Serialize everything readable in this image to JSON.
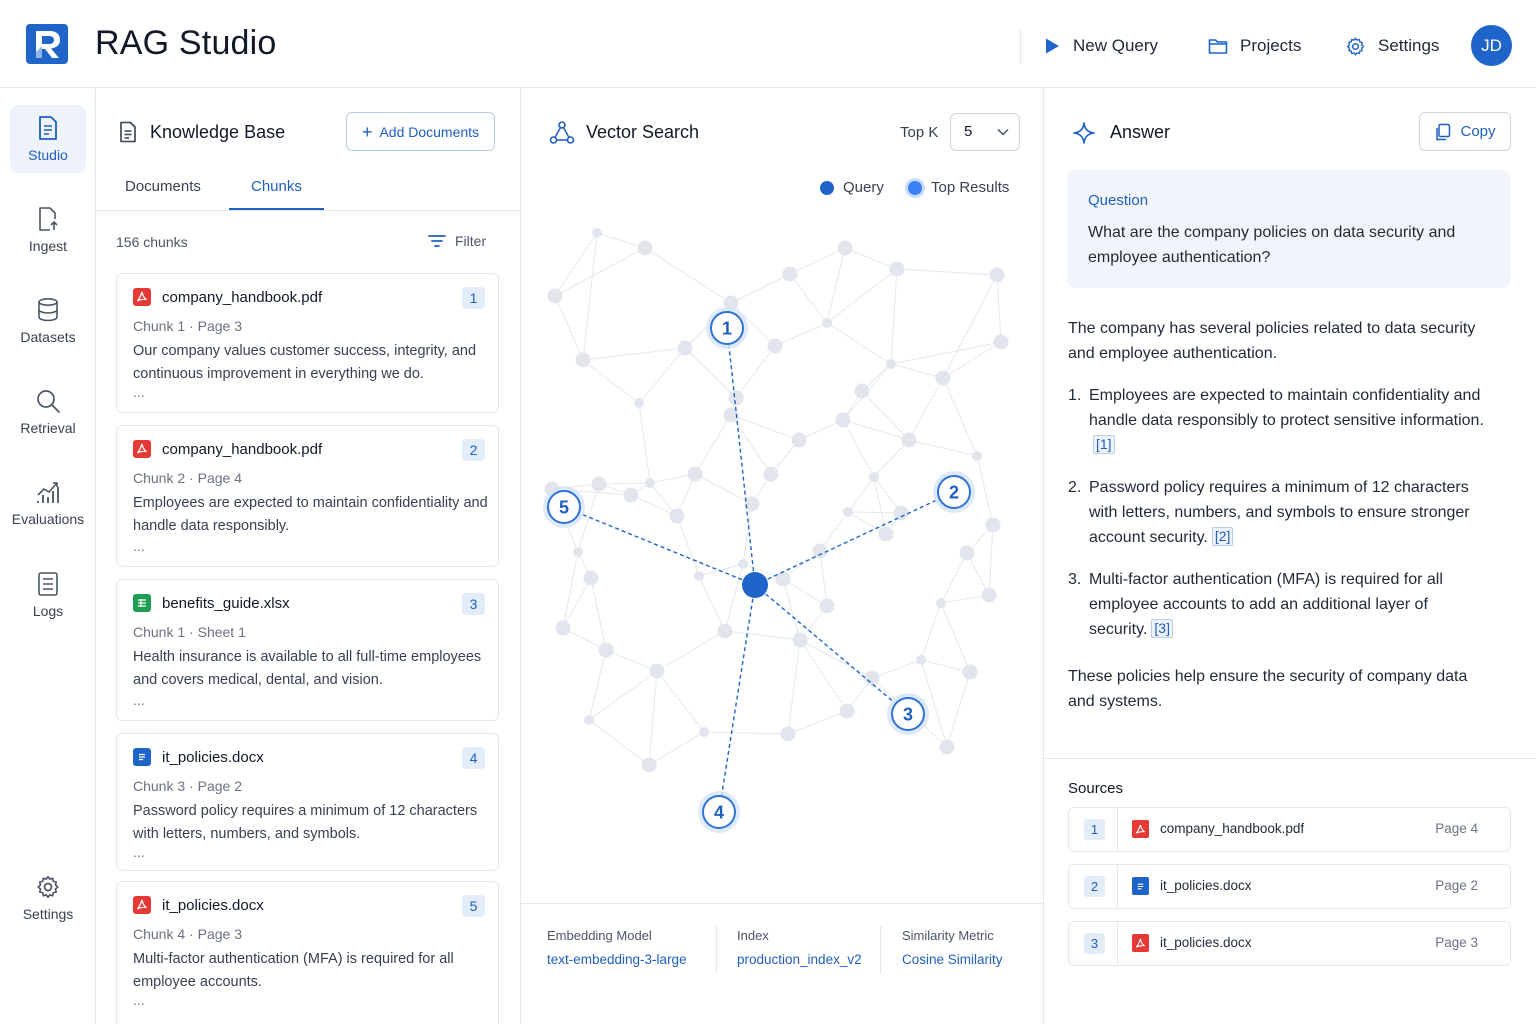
{
  "app": {
    "title": "RAG Studio",
    "logo_letter": "R",
    "brand_color": "#1f64c8"
  },
  "header": {
    "new_query": "New Query",
    "projects": "Projects",
    "settings": "Settings",
    "avatar_initials": "JD"
  },
  "nav": {
    "items": [
      {
        "label": "Studio",
        "icon": "document-icon",
        "active": true
      },
      {
        "label": "Ingest",
        "icon": "file-upload-icon"
      },
      {
        "label": "Datasets",
        "icon": "database-icon"
      },
      {
        "label": "Retrieval",
        "icon": "search-icon"
      },
      {
        "label": "Evaluations",
        "icon": "chart-icon"
      },
      {
        "label": "Logs",
        "icon": "log-icon"
      }
    ],
    "settings": "Settings"
  },
  "knowledge_base": {
    "title": "Knowledge Base",
    "add_button": "Add Documents",
    "tabs": [
      "Documents",
      "Chunks"
    ],
    "active_tab": "Chunks",
    "count": "156 chunks",
    "filter": "Filter",
    "chunks": [
      {
        "file": "company_handbook.pdf",
        "type": "pdf",
        "rank": "1",
        "chunk": "Chunk 1",
        "location": "Page 3",
        "text": "Our company values customer success, integrity, and continuous improvement in everything we do.",
        "ellipsis": "..."
      },
      {
        "file": "company_handbook.pdf",
        "type": "pdf",
        "rank": "2",
        "chunk": "Chunk 2",
        "location": "Page 4",
        "text": "Employees are expected to maintain confidentiality and handle data responsibly.",
        "ellipsis": "..."
      },
      {
        "file": "benefits_guide.xlsx",
        "type": "xlsx",
        "rank": "3",
        "chunk": "Chunk 1",
        "location": "Sheet 1",
        "text": "Health insurance is available to all full-time employees and covers medical, dental, and vision.",
        "ellipsis": "..."
      },
      {
        "file": "it_policies.docx",
        "type": "docx",
        "rank": "4",
        "chunk": "Chunk 3",
        "location": "Page 2",
        "text": "Password policy requires a minimum of 12 characters with letters, numbers, and symbols.",
        "ellipsis": "..."
      },
      {
        "file": "it_policies.docx",
        "type": "pdf",
        "rank": "5",
        "chunk": "Chunk 4",
        "location": "Page 3",
        "text": "Multi-factor authentication (MFA) is required for all employee accounts.",
        "ellipsis": "..."
      }
    ]
  },
  "vector_search": {
    "title": "Vector Search",
    "top_k_label": "Top K",
    "top_k_value": "5",
    "legend_query": "Query",
    "legend_results": "Top Results",
    "result_labels": [
      "1",
      "2",
      "3",
      "4",
      "5"
    ],
    "embedding_model_label": "Embedding Model",
    "embedding_model": "text-embedding-3-large",
    "index_label": "Index",
    "index": "production_index_v2",
    "metric_label": "Similarity Metric",
    "metric": "Cosine Similarity"
  },
  "answer": {
    "title": "Answer",
    "copy": "Copy",
    "question_label": "Question",
    "question": "What are the company policies on data security and employee authentication?",
    "intro": "The company has several policies related to data security and employee authentication.",
    "points": [
      {
        "num": "1.",
        "text": "Employees are expected to maintain confidentiality and handle data responsibly to protect sensitive information.",
        "cite": "[1]"
      },
      {
        "num": "2.",
        "text": "Password policy requires a minimum of 12 characters with letters, numbers, and symbols to ensure stronger account security.",
        "cite": "[2]"
      },
      {
        "num": "3.",
        "text": "Multi-factor authentication (MFA) is required for all employee accounts to add an additional layer of security.",
        "cite": "[3]"
      }
    ],
    "outro": "These policies help ensure the security of company data and systems.",
    "sources_title": "Sources",
    "sources": [
      {
        "num": "1",
        "file": "company_handbook.pdf",
        "type": "pdf",
        "page": "Page 4"
      },
      {
        "num": "2",
        "file": "it_policies.docx",
        "type": "docx",
        "page": "Page 2"
      },
      {
        "num": "3",
        "file": "it_policies.docx",
        "type": "pdf",
        "page": "Page 3"
      }
    ]
  }
}
